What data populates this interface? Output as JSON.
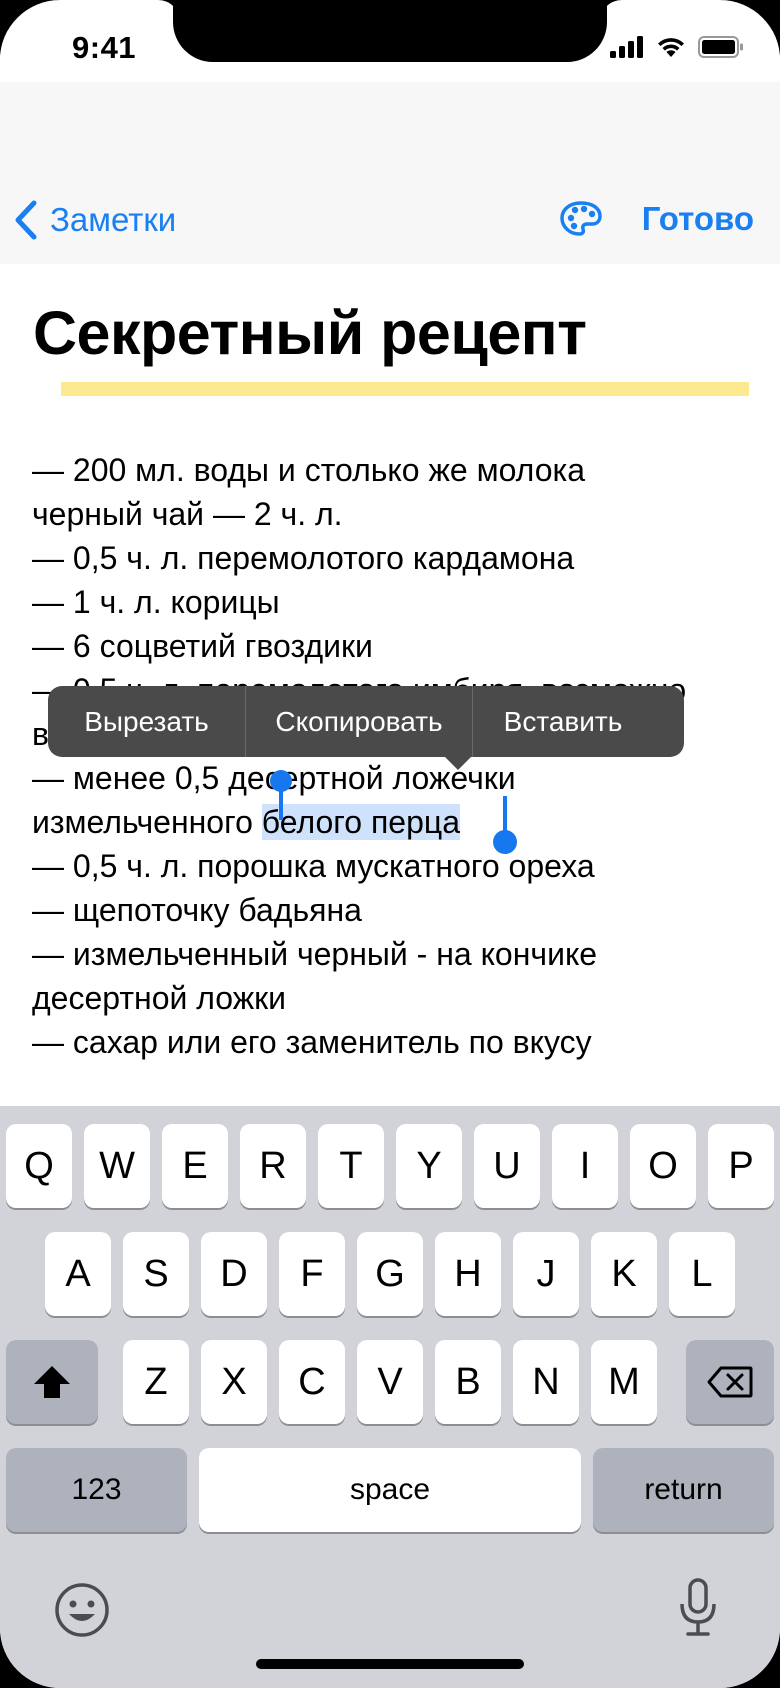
{
  "status_bar": {
    "time": "9:41"
  },
  "nav": {
    "back_label": "Заметки",
    "done_label": "Готово",
    "palette_icon": "palette-icon"
  },
  "note": {
    "title": "Секретный рецепт",
    "lines": [
      "— 200 мл. воды и столько же молока",
      "черный чай — 2 ч. л.",
      "— 0,5 ч. л. перемолотого кардамона",
      "— 1 ч. л. корицы",
      "— 6 соцветий гвоздики",
      "— 0,5 ч. л. перемолотого имбиря, возможно",
      "в",
      "— менее 0,5 десертной ложечки",
      "измельченного белого перца",
      "— 0,5 ч. л. порошка мускатного ореха",
      "— щепоточку бадьяна",
      "— измельченный черный - на кончике",
      "десертной ложки",
      "— сахар или его заменитель по вкусу"
    ],
    "selected_prefix": "измельченного ",
    "selected_text": "белого перца"
  },
  "edit_menu": {
    "cut": "Вырезать",
    "copy": "Скопировать",
    "paste": "Вставить"
  },
  "keyboard": {
    "row1": [
      "Q",
      "W",
      "E",
      "R",
      "T",
      "Y",
      "U",
      "I",
      "O",
      "P"
    ],
    "row2": [
      "A",
      "S",
      "D",
      "F",
      "G",
      "H",
      "J",
      "K",
      "L"
    ],
    "row3": [
      "Z",
      "X",
      "C",
      "V",
      "B",
      "N",
      "M"
    ],
    "numbers": "123",
    "space": "space",
    "return": "return"
  },
  "colors": {
    "accent": "#1a7ff0",
    "highlight": "#fde990",
    "selection": "#cfe2fb"
  }
}
